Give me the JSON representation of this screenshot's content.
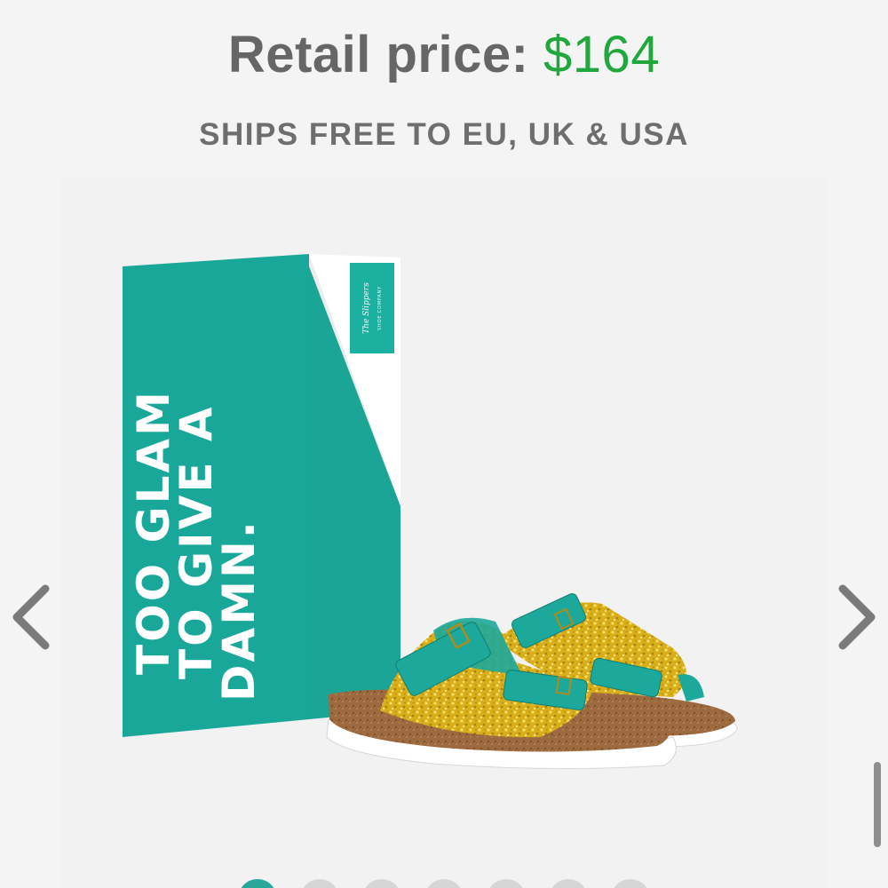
{
  "header": {
    "price_label": "Retail price:",
    "price_value": "$164",
    "shipping_note": "SHIPS FREE TO EU, UK & USA"
  },
  "product_box": {
    "slogan_lines": [
      "TOO GLAM",
      "TO GIVE A",
      "DAMN."
    ],
    "brand_script": "The Slippers",
    "brand_sub": "SHOE COMPANY"
  },
  "navigation": {
    "prev_icon": "chevron-left-icon",
    "next_icon": "chevron-right-icon"
  },
  "carousel": {
    "slide_count": 7,
    "active_index": 0
  },
  "colors": {
    "price_green": "#20a83c",
    "text_gray": "#666666",
    "box_teal": "#19a79a",
    "glitter_gold": "#d9b11d",
    "cork_brown": "#9c6a3e"
  }
}
